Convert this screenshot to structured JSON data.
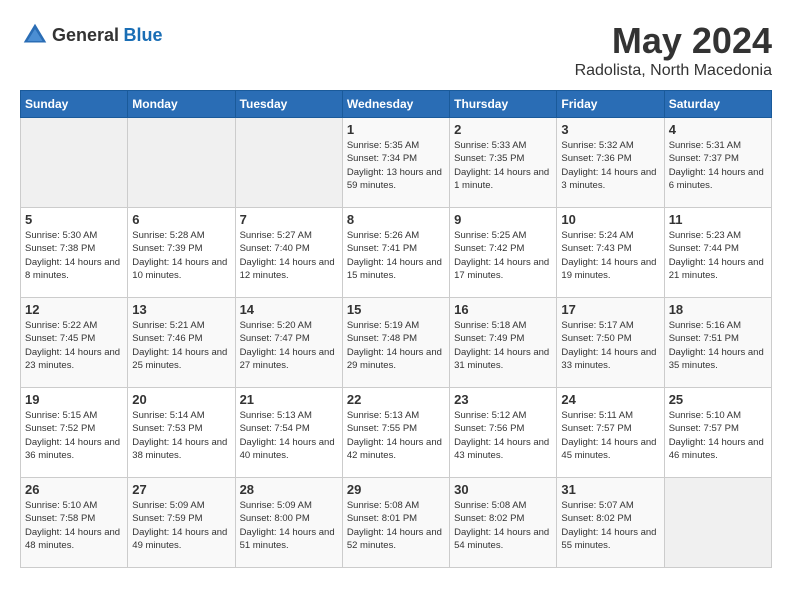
{
  "logo": {
    "text_general": "General",
    "text_blue": "Blue"
  },
  "title": "May 2024",
  "location": "Radolista, North Macedonia",
  "days_of_week": [
    "Sunday",
    "Monday",
    "Tuesday",
    "Wednesday",
    "Thursday",
    "Friday",
    "Saturday"
  ],
  "weeks": [
    [
      {
        "day": "",
        "sunrise": "",
        "sunset": "",
        "daylight": "",
        "empty": true
      },
      {
        "day": "",
        "sunrise": "",
        "sunset": "",
        "daylight": "",
        "empty": true
      },
      {
        "day": "",
        "sunrise": "",
        "sunset": "",
        "daylight": "",
        "empty": true
      },
      {
        "day": "1",
        "sunrise": "Sunrise: 5:35 AM",
        "sunset": "Sunset: 7:34 PM",
        "daylight": "Daylight: 13 hours and 59 minutes."
      },
      {
        "day": "2",
        "sunrise": "Sunrise: 5:33 AM",
        "sunset": "Sunset: 7:35 PM",
        "daylight": "Daylight: 14 hours and 1 minute."
      },
      {
        "day": "3",
        "sunrise": "Sunrise: 5:32 AM",
        "sunset": "Sunset: 7:36 PM",
        "daylight": "Daylight: 14 hours and 3 minutes."
      },
      {
        "day": "4",
        "sunrise": "Sunrise: 5:31 AM",
        "sunset": "Sunset: 7:37 PM",
        "daylight": "Daylight: 14 hours and 6 minutes."
      }
    ],
    [
      {
        "day": "5",
        "sunrise": "Sunrise: 5:30 AM",
        "sunset": "Sunset: 7:38 PM",
        "daylight": "Daylight: 14 hours and 8 minutes."
      },
      {
        "day": "6",
        "sunrise": "Sunrise: 5:28 AM",
        "sunset": "Sunset: 7:39 PM",
        "daylight": "Daylight: 14 hours and 10 minutes."
      },
      {
        "day": "7",
        "sunrise": "Sunrise: 5:27 AM",
        "sunset": "Sunset: 7:40 PM",
        "daylight": "Daylight: 14 hours and 12 minutes."
      },
      {
        "day": "8",
        "sunrise": "Sunrise: 5:26 AM",
        "sunset": "Sunset: 7:41 PM",
        "daylight": "Daylight: 14 hours and 15 minutes."
      },
      {
        "day": "9",
        "sunrise": "Sunrise: 5:25 AM",
        "sunset": "Sunset: 7:42 PM",
        "daylight": "Daylight: 14 hours and 17 minutes."
      },
      {
        "day": "10",
        "sunrise": "Sunrise: 5:24 AM",
        "sunset": "Sunset: 7:43 PM",
        "daylight": "Daylight: 14 hours and 19 minutes."
      },
      {
        "day": "11",
        "sunrise": "Sunrise: 5:23 AM",
        "sunset": "Sunset: 7:44 PM",
        "daylight": "Daylight: 14 hours and 21 minutes."
      }
    ],
    [
      {
        "day": "12",
        "sunrise": "Sunrise: 5:22 AM",
        "sunset": "Sunset: 7:45 PM",
        "daylight": "Daylight: 14 hours and 23 minutes."
      },
      {
        "day": "13",
        "sunrise": "Sunrise: 5:21 AM",
        "sunset": "Sunset: 7:46 PM",
        "daylight": "Daylight: 14 hours and 25 minutes."
      },
      {
        "day": "14",
        "sunrise": "Sunrise: 5:20 AM",
        "sunset": "Sunset: 7:47 PM",
        "daylight": "Daylight: 14 hours and 27 minutes."
      },
      {
        "day": "15",
        "sunrise": "Sunrise: 5:19 AM",
        "sunset": "Sunset: 7:48 PM",
        "daylight": "Daylight: 14 hours and 29 minutes."
      },
      {
        "day": "16",
        "sunrise": "Sunrise: 5:18 AM",
        "sunset": "Sunset: 7:49 PM",
        "daylight": "Daylight: 14 hours and 31 minutes."
      },
      {
        "day": "17",
        "sunrise": "Sunrise: 5:17 AM",
        "sunset": "Sunset: 7:50 PM",
        "daylight": "Daylight: 14 hours and 33 minutes."
      },
      {
        "day": "18",
        "sunrise": "Sunrise: 5:16 AM",
        "sunset": "Sunset: 7:51 PM",
        "daylight": "Daylight: 14 hours and 35 minutes."
      }
    ],
    [
      {
        "day": "19",
        "sunrise": "Sunrise: 5:15 AM",
        "sunset": "Sunset: 7:52 PM",
        "daylight": "Daylight: 14 hours and 36 minutes."
      },
      {
        "day": "20",
        "sunrise": "Sunrise: 5:14 AM",
        "sunset": "Sunset: 7:53 PM",
        "daylight": "Daylight: 14 hours and 38 minutes."
      },
      {
        "day": "21",
        "sunrise": "Sunrise: 5:13 AM",
        "sunset": "Sunset: 7:54 PM",
        "daylight": "Daylight: 14 hours and 40 minutes."
      },
      {
        "day": "22",
        "sunrise": "Sunrise: 5:13 AM",
        "sunset": "Sunset: 7:55 PM",
        "daylight": "Daylight: 14 hours and 42 minutes."
      },
      {
        "day": "23",
        "sunrise": "Sunrise: 5:12 AM",
        "sunset": "Sunset: 7:56 PM",
        "daylight": "Daylight: 14 hours and 43 minutes."
      },
      {
        "day": "24",
        "sunrise": "Sunrise: 5:11 AM",
        "sunset": "Sunset: 7:57 PM",
        "daylight": "Daylight: 14 hours and 45 minutes."
      },
      {
        "day": "25",
        "sunrise": "Sunrise: 5:10 AM",
        "sunset": "Sunset: 7:57 PM",
        "daylight": "Daylight: 14 hours and 46 minutes."
      }
    ],
    [
      {
        "day": "26",
        "sunrise": "Sunrise: 5:10 AM",
        "sunset": "Sunset: 7:58 PM",
        "daylight": "Daylight: 14 hours and 48 minutes."
      },
      {
        "day": "27",
        "sunrise": "Sunrise: 5:09 AM",
        "sunset": "Sunset: 7:59 PM",
        "daylight": "Daylight: 14 hours and 49 minutes."
      },
      {
        "day": "28",
        "sunrise": "Sunrise: 5:09 AM",
        "sunset": "Sunset: 8:00 PM",
        "daylight": "Daylight: 14 hours and 51 minutes."
      },
      {
        "day": "29",
        "sunrise": "Sunrise: 5:08 AM",
        "sunset": "Sunset: 8:01 PM",
        "daylight": "Daylight: 14 hours and 52 minutes."
      },
      {
        "day": "30",
        "sunrise": "Sunrise: 5:08 AM",
        "sunset": "Sunset: 8:02 PM",
        "daylight": "Daylight: 14 hours and 54 minutes."
      },
      {
        "day": "31",
        "sunrise": "Sunrise: 5:07 AM",
        "sunset": "Sunset: 8:02 PM",
        "daylight": "Daylight: 14 hours and 55 minutes."
      },
      {
        "day": "",
        "sunrise": "",
        "sunset": "",
        "daylight": "",
        "empty": true
      }
    ]
  ]
}
